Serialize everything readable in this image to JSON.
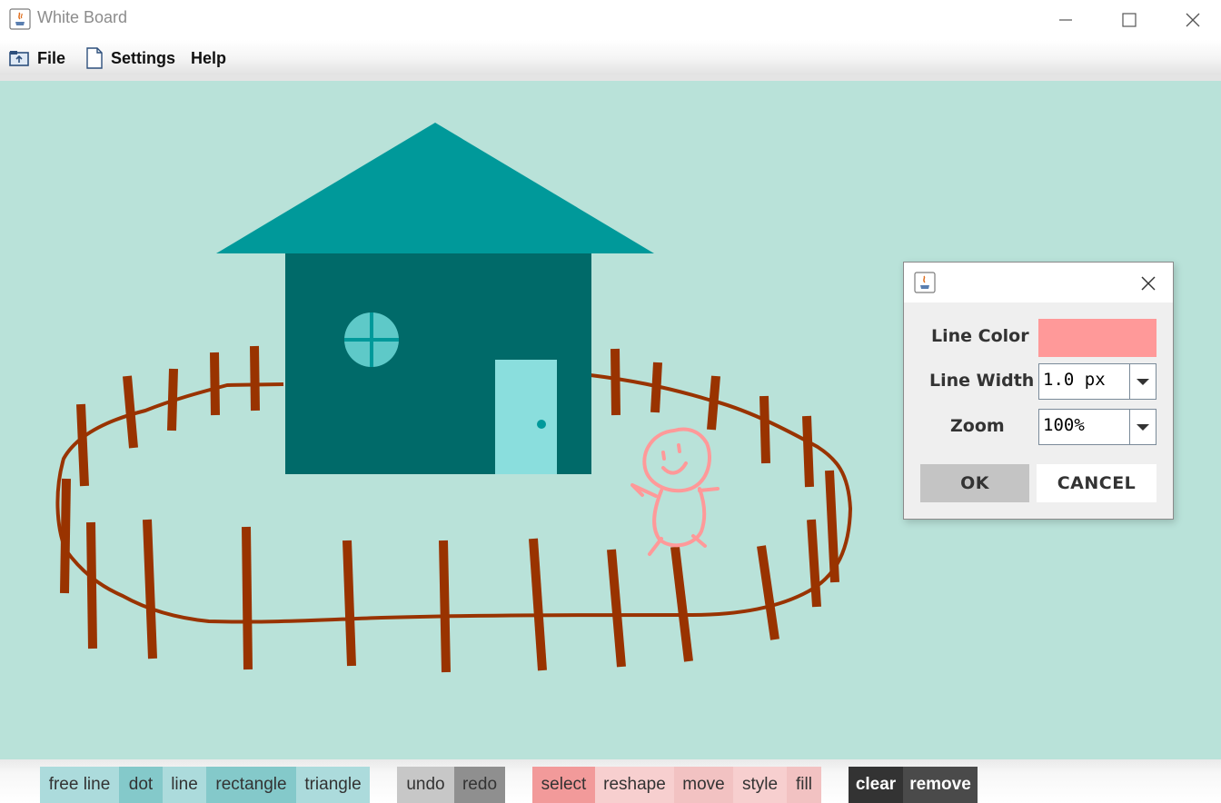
{
  "window": {
    "title": "White Board",
    "icon": "java-icon",
    "controls": [
      "minimize-icon",
      "maximize-icon",
      "close-icon"
    ]
  },
  "menu": {
    "items": [
      {
        "label": "File",
        "icon": "file-open-icon"
      },
      {
        "label": "Settings",
        "icon": "document-icon"
      },
      {
        "label": "Help",
        "icon": ""
      }
    ]
  },
  "canvas": {
    "background": "#b9e2d9",
    "drawing": [
      "house",
      "fence",
      "stick-figure"
    ],
    "colors": {
      "roof": "#00999a",
      "house_body": "#006a69",
      "window": "#5ec9c8",
      "door": "#8adedd",
      "fence": "#993300",
      "figure": "#ff9999"
    }
  },
  "dialog": {
    "icon": "java-icon",
    "line_color_label": "Line Color",
    "line_color_value": "#ff9999",
    "line_width_label": "Line Width",
    "line_width_value": "1.0  px",
    "zoom_label": "Zoom",
    "zoom_value": "100%",
    "ok_label": "OK",
    "cancel_label": "CANCEL"
  },
  "toolbar": {
    "draw_tools": [
      {
        "label": "free line",
        "color": "#acdbdc"
      },
      {
        "label": "dot",
        "color": "#84c9ca"
      },
      {
        "label": "line",
        "color": "#acdbdc"
      },
      {
        "label": "rectangle",
        "color": "#84c9ca"
      },
      {
        "label": "triangle",
        "color": "#acdbdc"
      }
    ],
    "history_tools": [
      {
        "label": "undo",
        "color": "#c7c7c7"
      },
      {
        "label": "redo",
        "color": "#8f8f8f"
      }
    ],
    "edit_tools": [
      {
        "label": "select",
        "color": "#f29a9a"
      },
      {
        "label": "reshape",
        "color": "#f7cfcf"
      },
      {
        "label": "move",
        "color": "#f2c2c2"
      },
      {
        "label": "style",
        "color": "#f7cfcf"
      },
      {
        "label": "fill",
        "color": "#f2c2c2"
      }
    ],
    "danger_tools": [
      {
        "label": "clear",
        "color": "#333333"
      },
      {
        "label": "remove",
        "color": "#4a4a4a"
      }
    ]
  }
}
